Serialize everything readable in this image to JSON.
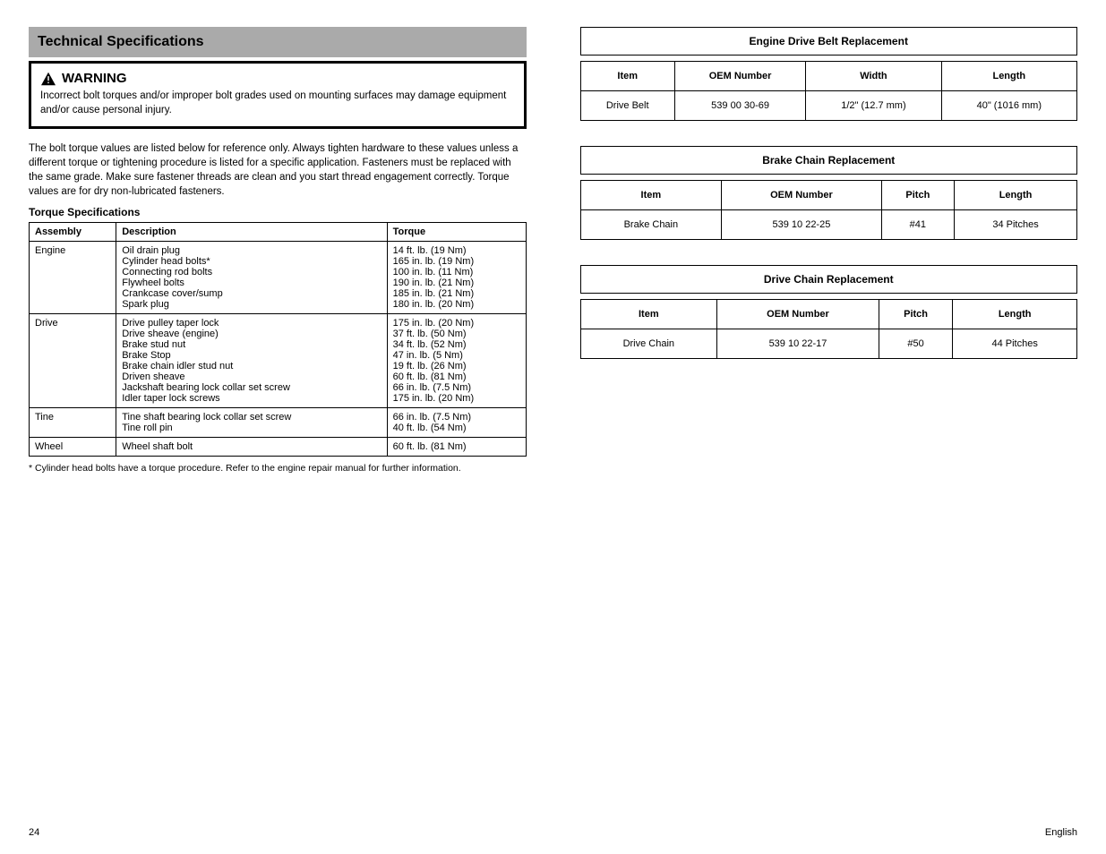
{
  "section_title": "Technical Specifications",
  "warning": {
    "label": "WARNING",
    "text": "Incorrect bolt torques and/or improper bolt grades used on mounting surfaces may damage equipment and/or cause personal injury."
  },
  "intro": "The bolt torque values are listed below for reference only. Always tighten hardware to these values unless a different torque or tightening procedure is listed for a specific application. Fasteners must be replaced with the same grade. Make sure fastener threads are clean and you start thread engagement correctly. Torque values are for dry non-lubricated fasteners.",
  "torque_table_title": "Torque Specifications",
  "torque_table": {
    "headers": [
      "Assembly",
      "Description",
      "Torque"
    ],
    "rows": [
      {
        "assembly": "Engine",
        "description": "Oil drain plug\nCylinder head bolts*\nConnecting rod bolts\nFlywheel bolts\nCrankcase cover/sump\nSpark plug",
        "torque": "14 ft. lb. (19 Nm)\n165 in. lb. (19 Nm)\n100 in. lb. (11 Nm)\n190 in. lb. (21 Nm)\n185 in. lb. (21 Nm)\n180 in. lb. (20 Nm)"
      },
      {
        "assembly": "Drive",
        "description": "Drive pulley taper lock\nDrive sheave (engine)\nBrake stud nut\nBrake Stop\nBrake chain idler stud nut\nDriven sheave\nJackshaft bearing lock collar set screw\nIdler taper lock screws",
        "torque": "175 in. lb. (20 Nm)\n37 ft. lb. (50 Nm)\n34 ft. lb. (52 Nm)\n47 in. lb. (5 Nm)\n19 ft. lb. (26 Nm)\n60 ft. lb. (81 Nm)\n66 in. lb. (7.5 Nm)\n175 in. lb. (20 Nm)"
      },
      {
        "assembly": "Tine",
        "description": "Tine shaft bearing lock collar set screw\nTine roll pin",
        "torque": "66 in. lb. (7.5 Nm)\n40 ft. lb. (54 Nm)"
      },
      {
        "assembly": "Wheel",
        "description": "Wheel shaft bolt",
        "torque": "60 ft. lb. (81 Nm)"
      }
    ]
  },
  "torque_footnote": "* Cylinder head bolts have a torque procedure. Refer to the engine repair manual for further information.",
  "right_tables": [
    {
      "title": "Engine Drive Belt Replacement",
      "headers": [
        "Item",
        "OEM Number",
        "Width",
        "Length"
      ],
      "row": [
        "Drive Belt",
        "539 00 30-69",
        "1/2\" (12.7 mm)",
        "40\" (1016 mm)"
      ]
    },
    {
      "title": "Brake Chain Replacement",
      "headers": [
        "Item",
        "OEM Number",
        "Pitch",
        "Length"
      ],
      "row": [
        "Brake Chain",
        "539 10 22-25",
        "#41",
        "34 Pitches"
      ]
    },
    {
      "title": "Drive Chain Replacement",
      "headers": [
        "Item",
        "OEM Number",
        "Pitch",
        "Length"
      ],
      "row": [
        "Drive Chain",
        "539 10 22-17",
        "#50",
        "44 Pitches"
      ]
    }
  ],
  "footer": {
    "left": "24",
    "right": "English"
  }
}
